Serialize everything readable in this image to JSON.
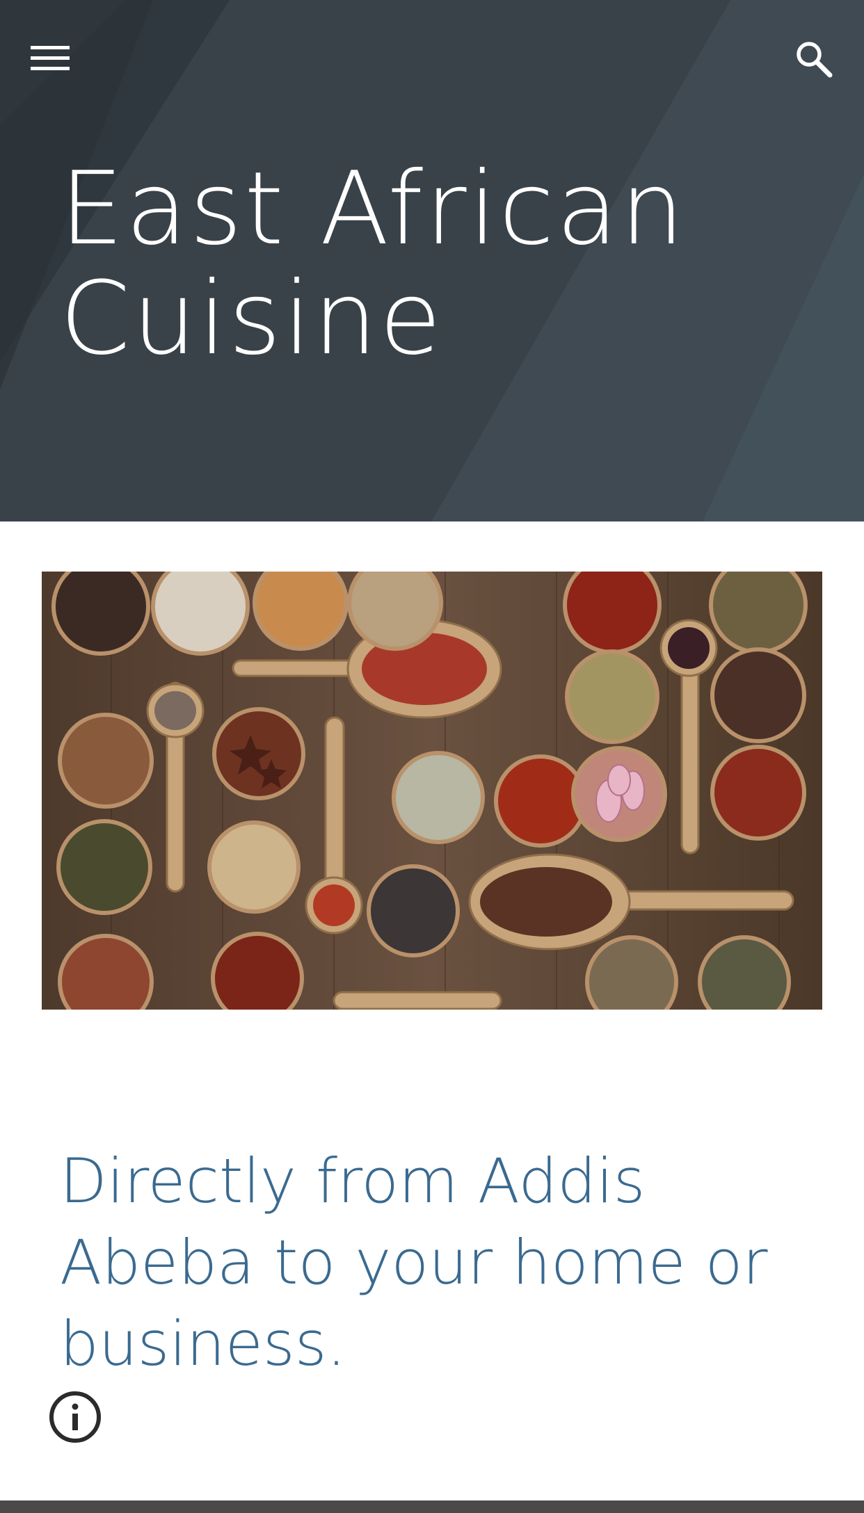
{
  "header": {
    "title": "East African Cuisine",
    "menu_icon": "hamburger-menu-icon",
    "search_icon": "search-icon",
    "background_color": "#363e45"
  },
  "main": {
    "image": {
      "subject": "spices-in-wooden-bowls-and-spoons"
    },
    "tagline": "Directly from Addis Abeba to your home or business.",
    "tagline_color": "#3a6a90"
  },
  "footer": {
    "info_icon": "info-icon"
  }
}
